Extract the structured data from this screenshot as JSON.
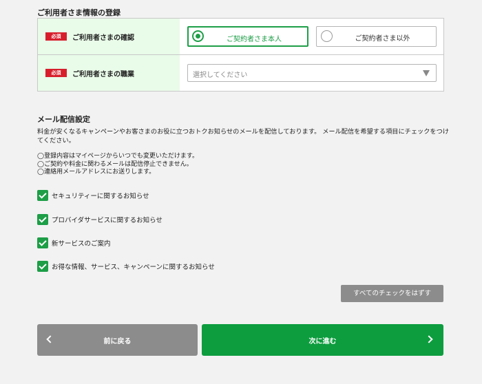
{
  "user_section": {
    "title": "ご利用者さま情報の登録",
    "required_badge": "必須",
    "confirm_label": "ご利用者さまの確認",
    "occupation_label": "ご利用者さまの職業",
    "radio_options": [
      {
        "label": "ご契約者さま本人",
        "selected": true
      },
      {
        "label": "ご契約者さま以外",
        "selected": false
      }
    ],
    "occupation_placeholder": "選択してください"
  },
  "mail_section": {
    "title": "メール配信設定",
    "description": "料金が安くなるキャンペーンやお客さまのお役に立つおトクお知らせのメールを配信しております。 メール配信を希望する項目にチェックをつけてください。",
    "notes": [
      "◯登録内容はマイページからいつでも変更いただけます。",
      "◯ご契約や料金に関わるメールは配信停止できません。",
      "◯連絡用メールアドレスにお送りします。"
    ],
    "checkboxes": [
      {
        "label": "セキュリティーに関するお知らせ",
        "checked": true
      },
      {
        "label": "プロバイダサービスに関するお知らせ",
        "checked": true
      },
      {
        "label": "新サービスのご案内",
        "checked": true
      },
      {
        "label": "お得な情報、サービス、キャンペーンに関するお知らせ",
        "checked": true
      }
    ],
    "uncheck_all_label": "すべてのチェックをはずす"
  },
  "navigation": {
    "back_label": "前に戻る",
    "next_label": "次に進む"
  },
  "colors": {
    "accent_green": "#1d9e47",
    "required_red": "#d71f2c",
    "label_bg": "#e9fbe9",
    "gray_button": "#8c8c8c"
  }
}
